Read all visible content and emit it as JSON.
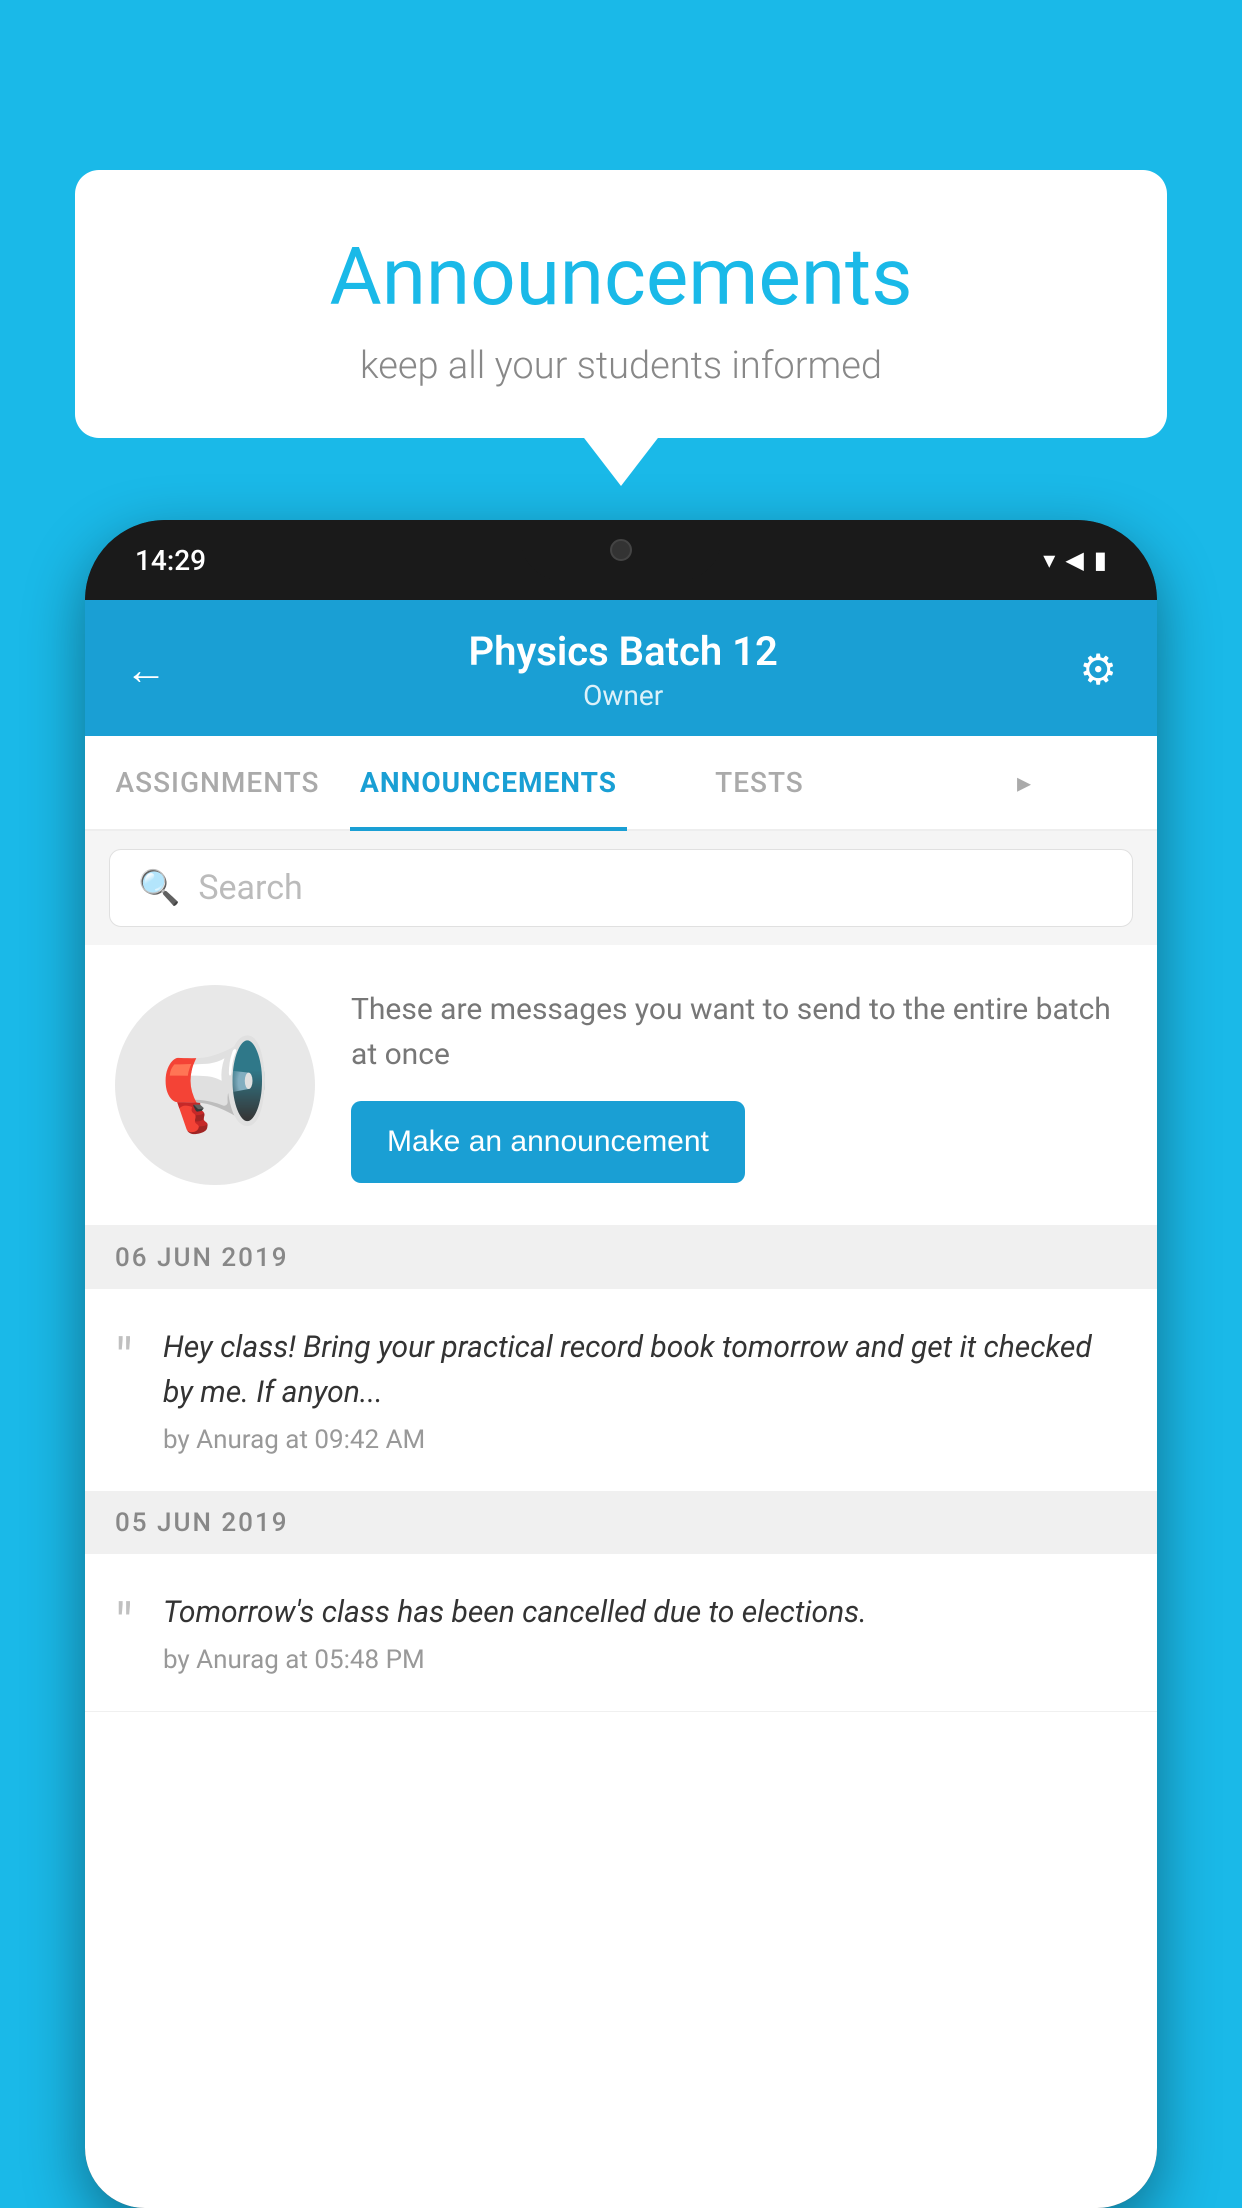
{
  "background_color": "#1ab9e8",
  "speech_bubble": {
    "title": "Announcements",
    "subtitle": "keep all your students informed"
  },
  "phone": {
    "status_bar": {
      "time": "14:29",
      "wifi": "▾",
      "signal": "▲",
      "battery": "▮"
    },
    "header": {
      "back_label": "←",
      "title": "Physics Batch 12",
      "subtitle": "Owner",
      "settings_label": "⚙"
    },
    "tabs": [
      {
        "label": "ASSIGNMENTS",
        "active": false
      },
      {
        "label": "ANNOUNCEMENTS",
        "active": true
      },
      {
        "label": "TESTS",
        "active": false
      },
      {
        "label": "...",
        "active": false
      }
    ],
    "search": {
      "placeholder": "Search"
    },
    "announcement_cta": {
      "description": "These are messages you want to send to the entire batch at once",
      "button_label": "Make an announcement"
    },
    "announcements": [
      {
        "date": "06  JUN  2019",
        "text": "Hey class! Bring your practical record book tomorrow and get it checked by me. If anyon...",
        "meta": "by Anurag at 09:42 AM"
      },
      {
        "date": "05  JUN  2019",
        "text": "Tomorrow's class has been cancelled due to elections.",
        "meta": "by Anurag at 05:48 PM"
      }
    ]
  }
}
